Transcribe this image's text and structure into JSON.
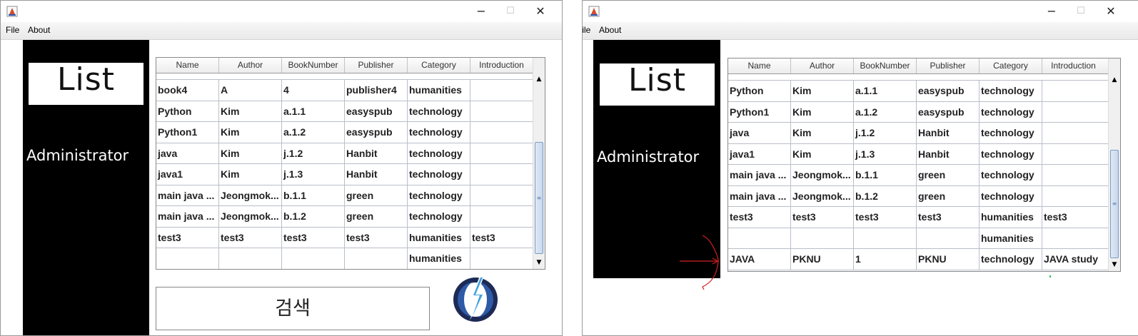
{
  "windows": [
    {
      "menu": [
        "File",
        "About"
      ],
      "side_title": "List",
      "side_role": "Administrator",
      "columns": [
        "Name",
        "Author",
        "BookNumber",
        "Publisher",
        "Category",
        "Introduction"
      ],
      "rows": [
        [
          "book4",
          "A",
          "4",
          "publisher4",
          "humanities",
          ""
        ],
        [
          "Python",
          "Kim",
          "a.1.1",
          "easyspub",
          "technology",
          ""
        ],
        [
          "Python1",
          "Kim",
          "a.1.2",
          "easyspub",
          "technology",
          ""
        ],
        [
          "java",
          "Kim",
          "j.1.2",
          "Hanbit",
          "technology",
          ""
        ],
        [
          "java1",
          "Kim",
          "j.1.3",
          "Hanbit",
          "technology",
          ""
        ],
        [
          "main java ...",
          "Jeongmok...",
          "b.1.1",
          "green",
          "technology",
          ""
        ],
        [
          "main java ...",
          "Jeongmok...",
          "b.1.2",
          "green",
          "technology",
          ""
        ],
        [
          "test3",
          "test3",
          "test3",
          "test3",
          "humanities",
          "test3"
        ],
        [
          "",
          "",
          "",
          "",
          "humanities",
          ""
        ]
      ],
      "search_label": "검색"
    },
    {
      "menu": [
        "File",
        "About"
      ],
      "side_title": "List",
      "side_role": "Administrator",
      "columns": [
        "Name",
        "Author",
        "BookNumber",
        "Publisher",
        "Category",
        "Introduction"
      ],
      "rows": [
        [
          "Python",
          "Kim",
          "a.1.1",
          "easyspub",
          "technology",
          ""
        ],
        [
          "Python1",
          "Kim",
          "a.1.2",
          "easyspub",
          "technology",
          ""
        ],
        [
          "java",
          "Kim",
          "j.1.2",
          "Hanbit",
          "technology",
          ""
        ],
        [
          "java1",
          "Kim",
          "j.1.3",
          "Hanbit",
          "technology",
          ""
        ],
        [
          "main java ...",
          "Jeongmok...",
          "b.1.1",
          "green",
          "technology",
          ""
        ],
        [
          "main java ...",
          "Jeongmok...",
          "b.1.2",
          "green",
          "technology",
          ""
        ],
        [
          "test3",
          "test3",
          "test3",
          "test3",
          "humanities",
          "test3"
        ],
        [
          "",
          "",
          "",
          "",
          "humanities",
          ""
        ],
        [
          "JAVA",
          "PKNU",
          "1",
          "PKNU",
          "technology",
          "JAVA study"
        ]
      ]
    }
  ],
  "colors": {
    "sidebar": "#000000",
    "logo_blue": "#2e5aa7",
    "logo_navy": "#1c2a55",
    "annotation_red": "#d32020"
  },
  "icons": [
    "app-icon",
    "minimize-icon",
    "maximize-icon",
    "close-icon",
    "scroll-up-arrow-icon",
    "scroll-down-arrow-icon",
    "app-logo-icon",
    "red-arrow-annotation-icon"
  ]
}
